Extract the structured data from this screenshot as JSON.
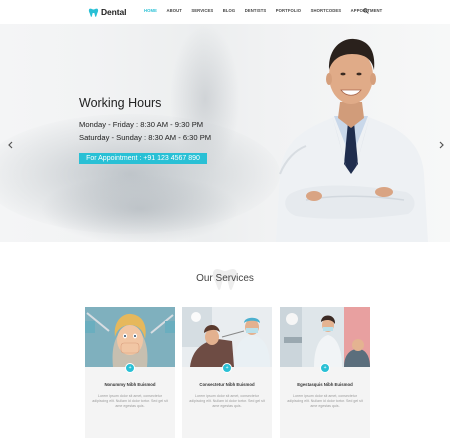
{
  "header": {
    "logo_text": "Dental",
    "nav": [
      "HOME",
      "ABOUT",
      "SERVICES",
      "BLOG",
      "DENTISTS",
      "PORTFOLIO",
      "SHORTCODES",
      "APPOINTMENT"
    ],
    "active_index": 0
  },
  "hero": {
    "title": "Working Hours",
    "line1": "Monday - Friday : 8:30 AM - 9:30 PM",
    "line2": "Saturday - Sunday : 8:30 AM - 6:30 PM",
    "cta": "For Appointment : +91 123 4567 890"
  },
  "services": {
    "title": "Our Services",
    "cards": [
      {
        "title": "Nonummy Nibh Euismod",
        "text": "Lorem ipsum dolor sit amet, consectetur adipiscing elit. Nullam id dolor tortor. Sed gel sit ame egestas quis."
      },
      {
        "title": "Consectetur Nibh Euismod",
        "text": "Lorem ipsum dolor sit amet, consectetur adipiscing elit. Nullam id dolor tortor. Sed gel sit ame egestas quis."
      },
      {
        "title": "Egestasquis Nibh Euismod",
        "text": "Lorem ipsum dolor sit amet, consectetur adipiscing elit. Nullam id dolor tortor. Sed gel sit ame egestas quis."
      }
    ]
  },
  "colors": {
    "accent": "#29c0d5",
    "text_dark": "#222222"
  },
  "icons": [
    "tooth-logo-icon",
    "search-icon",
    "chevron-left-icon",
    "chevron-right-icon",
    "plus-icon"
  ]
}
